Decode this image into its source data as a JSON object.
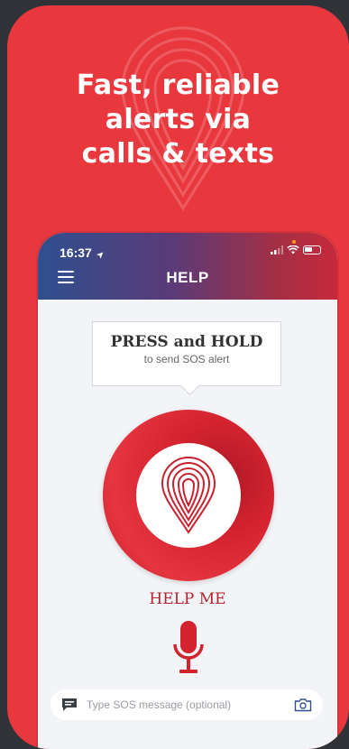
{
  "headline": [
    "Fast, reliable",
    "alerts via",
    "calls & texts"
  ],
  "status": {
    "time": "16:37",
    "location_arrow": "➤"
  },
  "header": {
    "title": "HELP"
  },
  "tooltip": {
    "title": "PRESS and HOLD",
    "subtitle": "to send SOS alert"
  },
  "sos": {
    "label": "HELP ME"
  },
  "message": {
    "placeholder": "Type SOS message (optional)",
    "value": ""
  },
  "icons": [
    "menu-icon",
    "location-arrow-icon",
    "signal-icon",
    "wifi-icon",
    "battery-icon",
    "location-pin-icon",
    "microphone-icon",
    "chat-icon",
    "camera-icon"
  ],
  "colors": {
    "brand_red": "#e8383e",
    "button_red": "#d3232f",
    "text_red": "#b3232e",
    "header_blue": "#2f4f8f"
  }
}
